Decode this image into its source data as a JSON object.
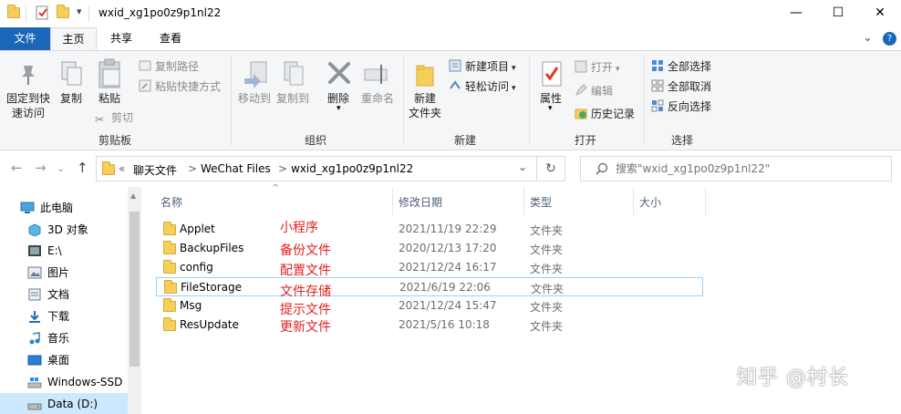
{
  "window": {
    "title": "wxid_xg1po0z9p1nl22",
    "minimize_glyph": "—",
    "maximize_glyph": "☐",
    "close_glyph": "✕",
    "quick_access_dropdown": "▾"
  },
  "ribbon_tabs": {
    "file": "文件",
    "home": "主页",
    "share": "共享",
    "view": "查看"
  },
  "ribbon_right": {
    "collapse_glyph": "⌄",
    "help_glyph": "?"
  },
  "clipboard": {
    "group_label": "剪贴板",
    "pin_label_1": "固定到快",
    "pin_label_2": "速访问",
    "copy": "复制",
    "paste": "粘贴",
    "copy_path": "复制路径",
    "paste_shortcut": "粘贴快捷方式",
    "cut": "剪切"
  },
  "organize": {
    "group_label": "组织",
    "move_to": "移动到",
    "copy_to": "复制到",
    "delete": "删除",
    "rename": "重命名"
  },
  "new_group": {
    "group_label": "新建",
    "new_folder_1": "新建",
    "new_folder_2": "文件夹",
    "new_item": "新建项目",
    "easy_access": "轻松访问"
  },
  "open_group": {
    "group_label": "打开",
    "properties": "属性",
    "open": "打开",
    "edit": "编辑",
    "history": "历史记录"
  },
  "select_group": {
    "group_label": "选择",
    "select_all": "全部选择",
    "select_none": "全部取消",
    "invert": "反向选择"
  },
  "nav": {
    "back": "←",
    "forward": "→",
    "recent": "⌄",
    "up": "↑",
    "breadcrumb_overflow": "«",
    "crumbs": [
      "聊天文件",
      "WeChat Files",
      "wxid_xg1po0z9p1nl22"
    ],
    "crumb_sep": ">",
    "address_dropdown": "⌄",
    "refresh": "↻",
    "search_placeholder": "搜索\"wxid_xg1po0z9p1nl22\""
  },
  "navpane": {
    "items": [
      {
        "label": "此电脑"
      },
      {
        "label": "3D 对象"
      },
      {
        "label": "E:\\"
      },
      {
        "label": "图片"
      },
      {
        "label": "文档"
      },
      {
        "label": "下载"
      },
      {
        "label": "音乐"
      },
      {
        "label": "桌面"
      },
      {
        "label": "Windows-SSD"
      },
      {
        "label": "Data (D:)"
      }
    ]
  },
  "columns": {
    "name": "名称",
    "modified": "修改日期",
    "type": "类型",
    "size": "大小",
    "sort_glyph": "^"
  },
  "files": [
    {
      "name": "Applet",
      "date": "2021/11/19 22:29",
      "type": "文件夹",
      "note": "小程序"
    },
    {
      "name": "BackupFiles",
      "date": "2020/12/13 17:20",
      "type": "文件夹",
      "note": "备份文件"
    },
    {
      "name": "config",
      "date": "2021/12/24 16:17",
      "type": "文件夹",
      "note": "配置文件"
    },
    {
      "name": "FileStorage",
      "date": "2021/6/19 22:06",
      "type": "文件夹",
      "note": "文件存储"
    },
    {
      "name": "Msg",
      "date": "2021/12/24 15:47",
      "type": "文件夹",
      "note": "提示文件"
    },
    {
      "name": "ResUpdate",
      "date": "2021/5/16 10:18",
      "type": "文件夹",
      "note": "更新文件"
    }
  ],
  "selected_row_index": 3,
  "watermark": "知乎 @村长",
  "colors": {
    "file_tab": "#1a66b8",
    "annotation": "#e0211c",
    "folder": "#f6cf5a",
    "selection_border": "#99d1ff"
  }
}
